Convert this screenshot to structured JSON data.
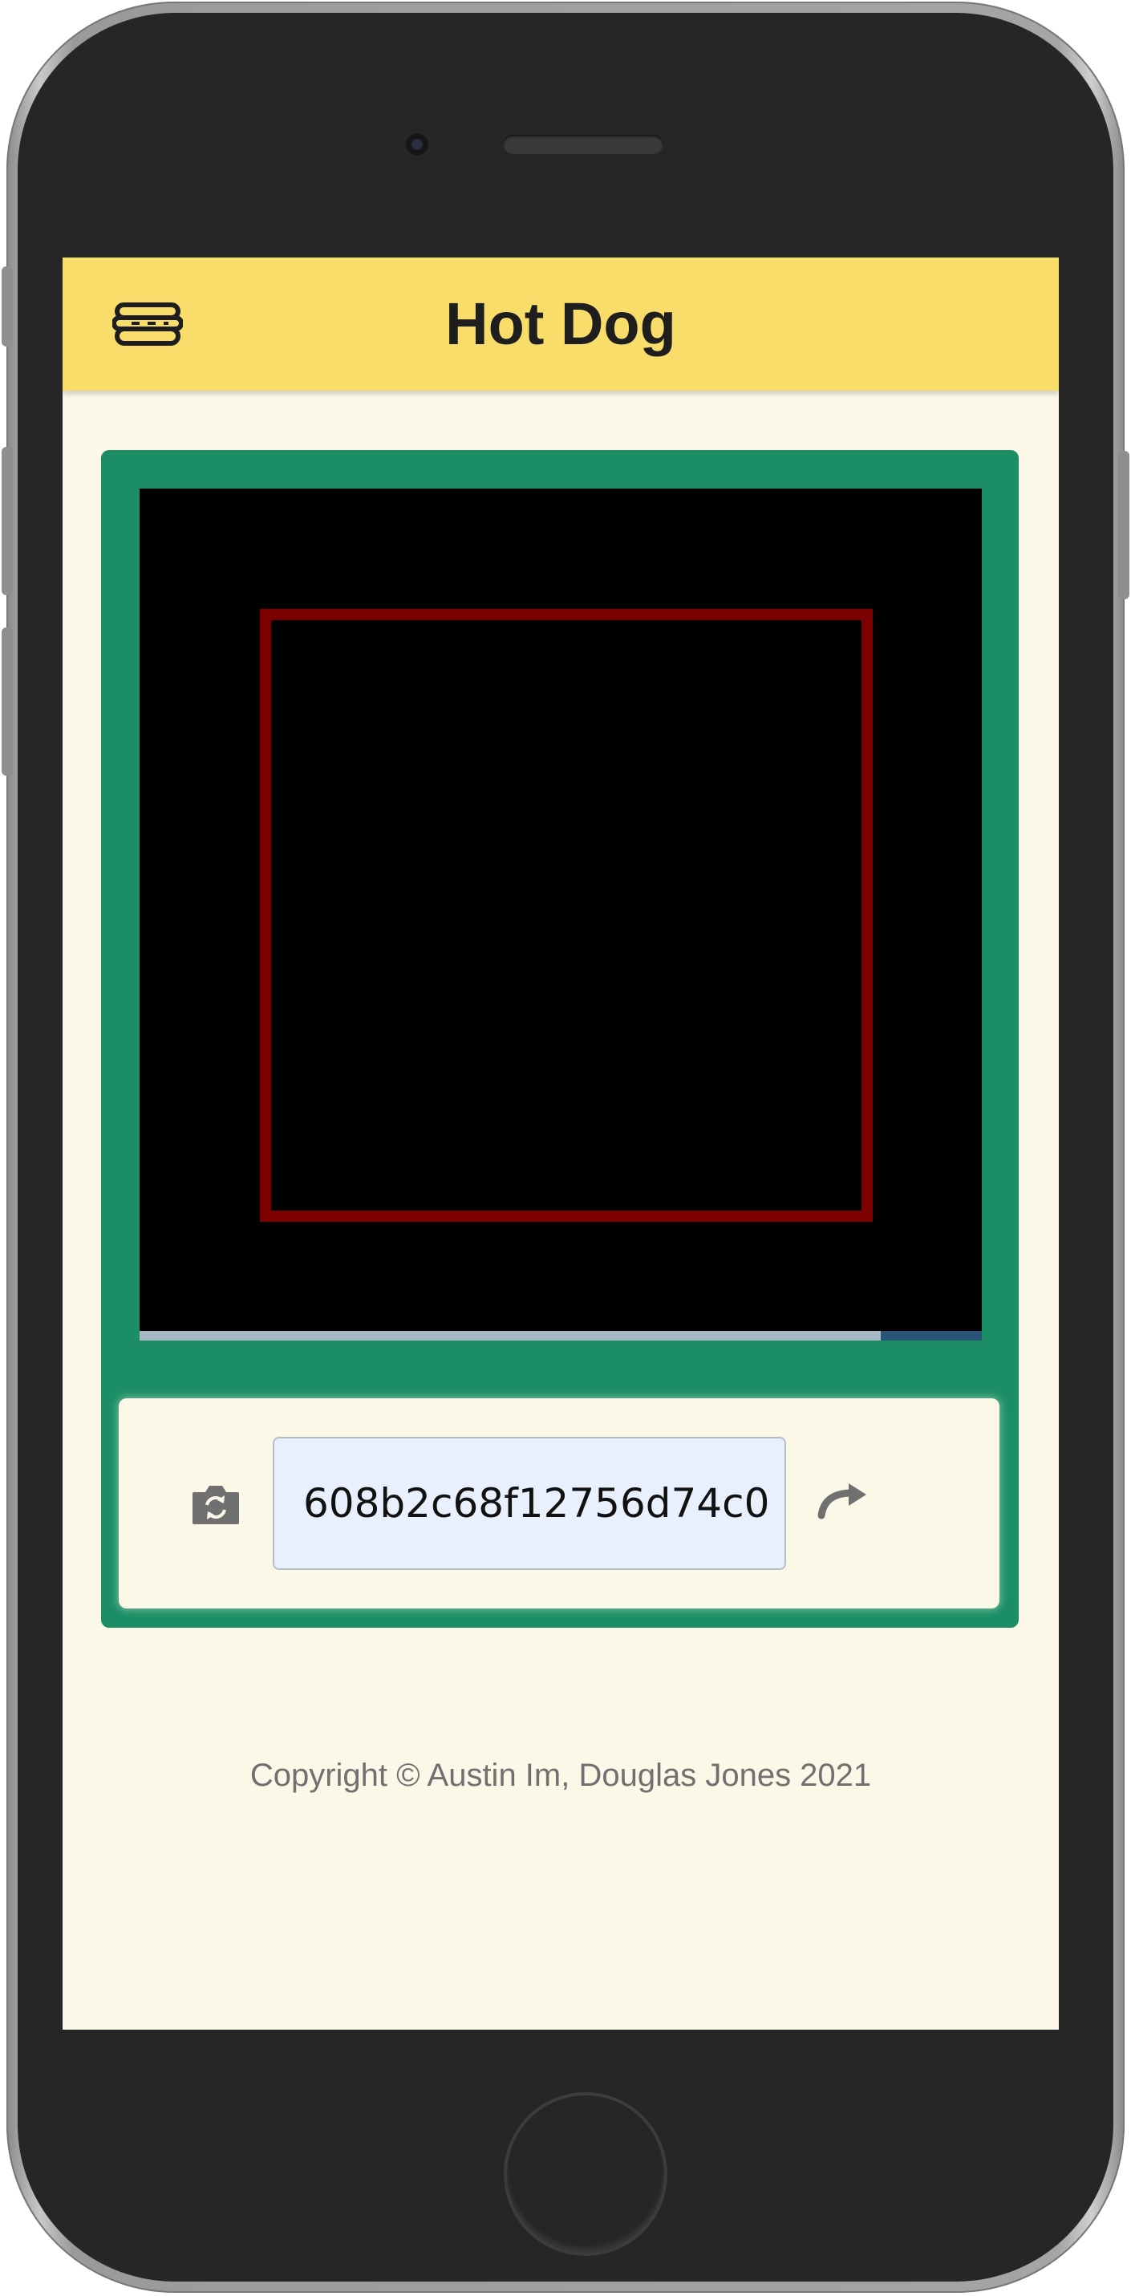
{
  "app": {
    "title": "Hot Dog"
  },
  "icons": {
    "logo": "hot-dog-icon",
    "camera": "camera-switch-icon",
    "redo": "redo-icon"
  },
  "scanner": {
    "progress_fraction": 0.88
  },
  "controls": {
    "hash_value": "608b2c68f12756d74c0"
  },
  "footer": {
    "copyright": "Copyright © Austin Im, Douglas Jones 2021"
  },
  "colors": {
    "appbar": "#f9dd6a",
    "panel": "#1b8e65",
    "scan_box": "#7c0000",
    "background": "#fcf8e8"
  }
}
